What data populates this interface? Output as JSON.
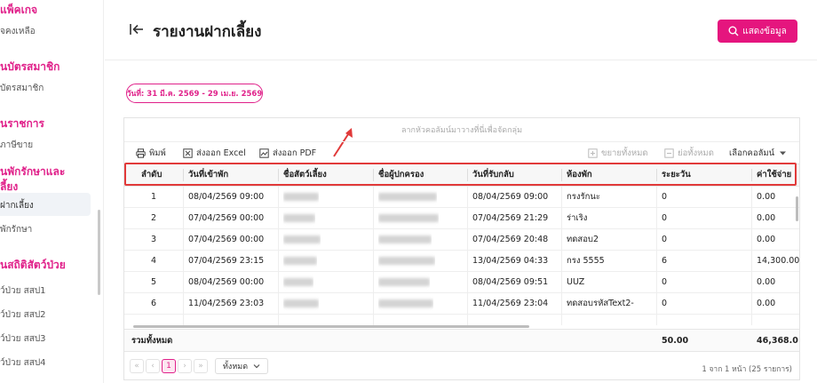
{
  "sidebar": {
    "sections": [
      {
        "heading": "แพ็คเกจ",
        "items": [
          "จคงเหลือ"
        ]
      },
      {
        "heading": "นบัตรสมาชิก",
        "items": [
          "บัตรสมาชิก"
        ]
      },
      {
        "heading": "นราชการ",
        "items": [
          "ภาษีขาย"
        ]
      },
      {
        "heading": "นพักรักษาและ",
        "heading2": "ลี้ยง",
        "items": [
          "ฝากเลี้ยง",
          "พักรักษา"
        ]
      },
      {
        "heading": "นสถิติสัตว์ป่วย",
        "items": [
          "ว์ป่วย สสป1",
          "ว์ป่วย สสป2",
          "ว์ป่วย สสป3",
          "ว์ป่วย สสป4"
        ]
      }
    ]
  },
  "header": {
    "title": "รายงานฝากเลี้ยง",
    "show_button": "แสดงข้อมูล"
  },
  "filter": {
    "date_range": "วันที่: 31 มี.ค. 2569 - 29 เม.ย. 2569"
  },
  "grid": {
    "group_hint": "ลากหัวคอลัมน์มาวางที่นี่เพื่อจัดกลุ่ม",
    "toolbar": {
      "print": "พิมพ์",
      "export_excel": "ส่งออก Excel",
      "export_pdf": "ส่งออก PDF",
      "expand_all": "ขยายทั้งหมด",
      "collapse_all": "ย่อทั้งหมด",
      "choose_columns": "เลือกคอลัมน์"
    },
    "columns": [
      "ลำดับ",
      "วันที่เข้าพัก",
      "ชื่อสัตว์เลี้ยง",
      "ชื่อผู้ปกครอง",
      "วันที่รับกลับ",
      "ห้องพัก",
      "ระยะวัน",
      "ค่าใช้จ่าย"
    ],
    "rows": [
      {
        "no": "1",
        "checkin": "08/04/2569 09:00",
        "checkout": "08/04/2569 09:00",
        "room": "กรงรักนะ",
        "days": "0",
        "cost": "0.00"
      },
      {
        "no": "2",
        "checkin": "07/04/2569 00:00",
        "checkout": "07/04/2569 21:29",
        "room": "ร่าเริง",
        "days": "0",
        "cost": "0.00"
      },
      {
        "no": "3",
        "checkin": "07/04/2569 00:00",
        "checkout": "07/04/2569 20:48",
        "room": "ทดสอบ2",
        "days": "0",
        "cost": "0.00"
      },
      {
        "no": "4",
        "checkin": "07/04/2569 23:15",
        "checkout": "13/04/2569 04:33",
        "room": "กรง 5555",
        "days": "6",
        "cost": "14,300.00"
      },
      {
        "no": "5",
        "checkin": "08/04/2569 00:00",
        "checkout": "08/04/2569 09:51",
        "room": "UUZ",
        "days": "0",
        "cost": "0.00"
      },
      {
        "no": "6",
        "checkin": "11/04/2569 23:03",
        "checkout": "11/04/2569 23:04",
        "room": "ทดสอบรหัสText2-",
        "days": "0",
        "cost": "0.00"
      }
    ],
    "footer": {
      "label": "รวมทั้งหมด",
      "days_total": "50.00",
      "cost_total": "46,368.0"
    },
    "pager": {
      "current_page": "1",
      "page_size": "ทั้งหมด",
      "info": "1 จาก 1 หน้า (25 รายการ)"
    }
  },
  "colors": {
    "accent": "#e5157e",
    "highlight_box": "#e13a3a"
  }
}
